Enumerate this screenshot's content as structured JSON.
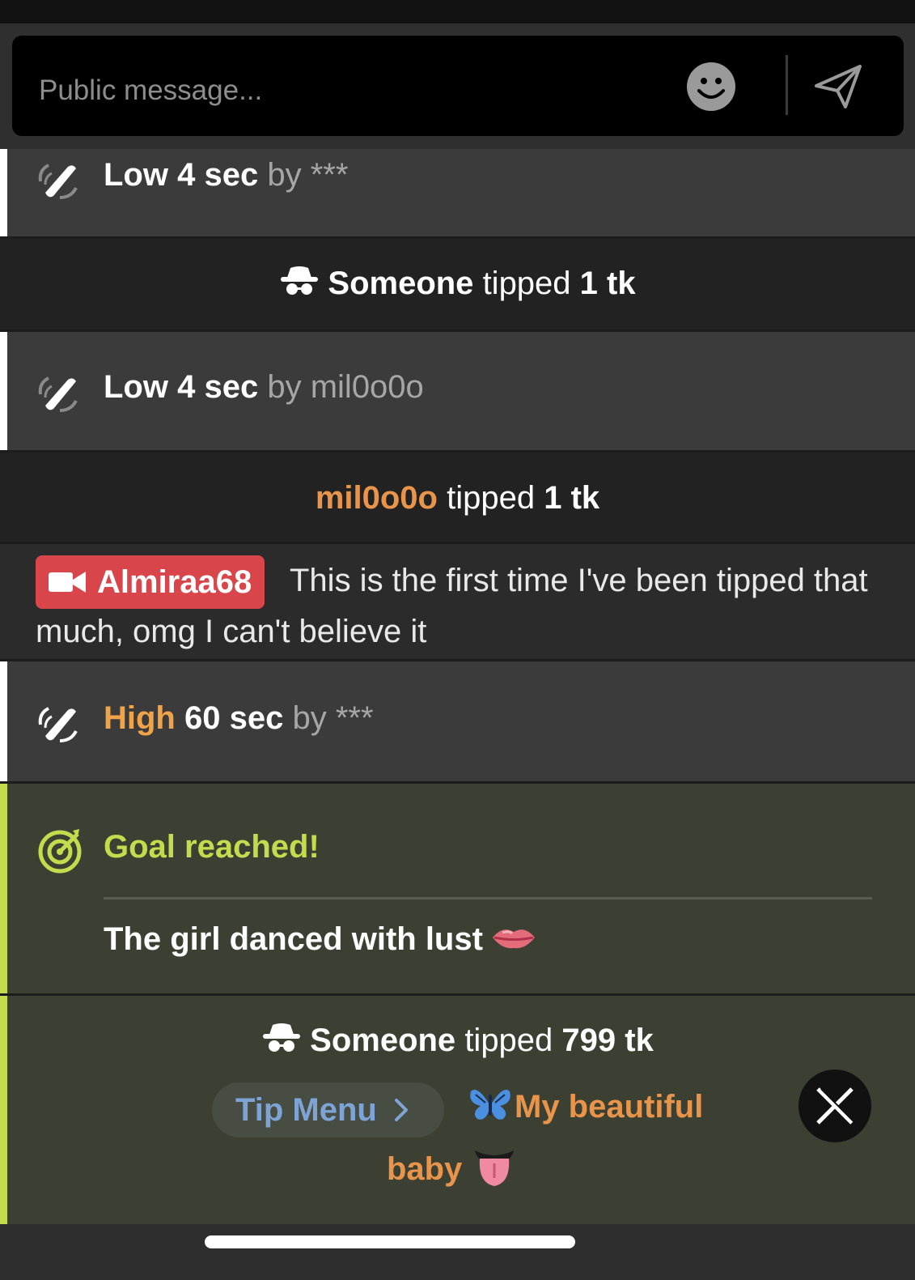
{
  "composer": {
    "placeholder": "Public message...",
    "emoji_icon": "smiley-icon",
    "send_icon": "paper-plane-icon"
  },
  "feed": [
    {
      "type": "vibration",
      "level": "Low",
      "duration": "4 sec",
      "by_label": "by",
      "user": "***"
    },
    {
      "type": "tip",
      "user": "Someone",
      "verb": "tipped",
      "amount": "1 tk",
      "anonymous": true
    },
    {
      "type": "vibration",
      "level": "Low",
      "duration": "4 sec",
      "by_label": "by",
      "user": "mil0o0o"
    },
    {
      "type": "tip",
      "user": "mil0o0o",
      "verb": "tipped",
      "amount": "1 tk",
      "anonymous": false
    },
    {
      "type": "model_message",
      "sender": "Almiraa68",
      "text": "This is the first time I've been tipped that much, omg I can't believe it"
    },
    {
      "type": "vibration",
      "level": "High",
      "duration": "60 sec",
      "by_label": "by",
      "user": "***"
    },
    {
      "type": "goal",
      "title": "Goal reached!",
      "description": "The girl danced with lust"
    },
    {
      "type": "tip_menu",
      "user": "Someone",
      "verb": "tipped",
      "amount": "799 tk",
      "button_label": "Tip Menu",
      "item_line1": "My beautiful",
      "item_line2": "baby"
    }
  ],
  "colors": {
    "accent_orange": "#e8944a",
    "goal_lime": "#c3dc4e",
    "badge_red": "#d8454b",
    "tip_menu_blue": "#7ea4d6"
  }
}
